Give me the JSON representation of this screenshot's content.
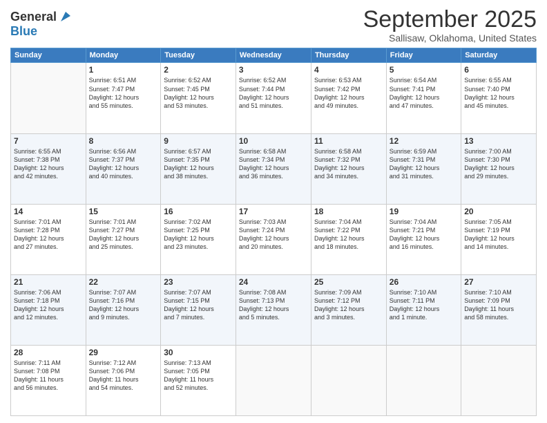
{
  "header": {
    "logo_line1": "General",
    "logo_line2": "Blue",
    "main_title": "September 2025",
    "subtitle": "Sallisaw, Oklahoma, United States"
  },
  "days_of_week": [
    "Sunday",
    "Monday",
    "Tuesday",
    "Wednesday",
    "Thursday",
    "Friday",
    "Saturday"
  ],
  "weeks": [
    [
      {
        "day": "",
        "info": ""
      },
      {
        "day": "1",
        "info": "Sunrise: 6:51 AM\nSunset: 7:47 PM\nDaylight: 12 hours\nand 55 minutes."
      },
      {
        "day": "2",
        "info": "Sunrise: 6:52 AM\nSunset: 7:45 PM\nDaylight: 12 hours\nand 53 minutes."
      },
      {
        "day": "3",
        "info": "Sunrise: 6:52 AM\nSunset: 7:44 PM\nDaylight: 12 hours\nand 51 minutes."
      },
      {
        "day": "4",
        "info": "Sunrise: 6:53 AM\nSunset: 7:42 PM\nDaylight: 12 hours\nand 49 minutes."
      },
      {
        "day": "5",
        "info": "Sunrise: 6:54 AM\nSunset: 7:41 PM\nDaylight: 12 hours\nand 47 minutes."
      },
      {
        "day": "6",
        "info": "Sunrise: 6:55 AM\nSunset: 7:40 PM\nDaylight: 12 hours\nand 45 minutes."
      }
    ],
    [
      {
        "day": "7",
        "info": "Sunrise: 6:55 AM\nSunset: 7:38 PM\nDaylight: 12 hours\nand 42 minutes."
      },
      {
        "day": "8",
        "info": "Sunrise: 6:56 AM\nSunset: 7:37 PM\nDaylight: 12 hours\nand 40 minutes."
      },
      {
        "day": "9",
        "info": "Sunrise: 6:57 AM\nSunset: 7:35 PM\nDaylight: 12 hours\nand 38 minutes."
      },
      {
        "day": "10",
        "info": "Sunrise: 6:58 AM\nSunset: 7:34 PM\nDaylight: 12 hours\nand 36 minutes."
      },
      {
        "day": "11",
        "info": "Sunrise: 6:58 AM\nSunset: 7:32 PM\nDaylight: 12 hours\nand 34 minutes."
      },
      {
        "day": "12",
        "info": "Sunrise: 6:59 AM\nSunset: 7:31 PM\nDaylight: 12 hours\nand 31 minutes."
      },
      {
        "day": "13",
        "info": "Sunrise: 7:00 AM\nSunset: 7:30 PM\nDaylight: 12 hours\nand 29 minutes."
      }
    ],
    [
      {
        "day": "14",
        "info": "Sunrise: 7:01 AM\nSunset: 7:28 PM\nDaylight: 12 hours\nand 27 minutes."
      },
      {
        "day": "15",
        "info": "Sunrise: 7:01 AM\nSunset: 7:27 PM\nDaylight: 12 hours\nand 25 minutes."
      },
      {
        "day": "16",
        "info": "Sunrise: 7:02 AM\nSunset: 7:25 PM\nDaylight: 12 hours\nand 23 minutes."
      },
      {
        "day": "17",
        "info": "Sunrise: 7:03 AM\nSunset: 7:24 PM\nDaylight: 12 hours\nand 20 minutes."
      },
      {
        "day": "18",
        "info": "Sunrise: 7:04 AM\nSunset: 7:22 PM\nDaylight: 12 hours\nand 18 minutes."
      },
      {
        "day": "19",
        "info": "Sunrise: 7:04 AM\nSunset: 7:21 PM\nDaylight: 12 hours\nand 16 minutes."
      },
      {
        "day": "20",
        "info": "Sunrise: 7:05 AM\nSunset: 7:19 PM\nDaylight: 12 hours\nand 14 minutes."
      }
    ],
    [
      {
        "day": "21",
        "info": "Sunrise: 7:06 AM\nSunset: 7:18 PM\nDaylight: 12 hours\nand 12 minutes."
      },
      {
        "day": "22",
        "info": "Sunrise: 7:07 AM\nSunset: 7:16 PM\nDaylight: 12 hours\nand 9 minutes."
      },
      {
        "day": "23",
        "info": "Sunrise: 7:07 AM\nSunset: 7:15 PM\nDaylight: 12 hours\nand 7 minutes."
      },
      {
        "day": "24",
        "info": "Sunrise: 7:08 AM\nSunset: 7:13 PM\nDaylight: 12 hours\nand 5 minutes."
      },
      {
        "day": "25",
        "info": "Sunrise: 7:09 AM\nSunset: 7:12 PM\nDaylight: 12 hours\nand 3 minutes."
      },
      {
        "day": "26",
        "info": "Sunrise: 7:10 AM\nSunset: 7:11 PM\nDaylight: 12 hours\nand 1 minute."
      },
      {
        "day": "27",
        "info": "Sunrise: 7:10 AM\nSunset: 7:09 PM\nDaylight: 11 hours\nand 58 minutes."
      }
    ],
    [
      {
        "day": "28",
        "info": "Sunrise: 7:11 AM\nSunset: 7:08 PM\nDaylight: 11 hours\nand 56 minutes."
      },
      {
        "day": "29",
        "info": "Sunrise: 7:12 AM\nSunset: 7:06 PM\nDaylight: 11 hours\nand 54 minutes."
      },
      {
        "day": "30",
        "info": "Sunrise: 7:13 AM\nSunset: 7:05 PM\nDaylight: 11 hours\nand 52 minutes."
      },
      {
        "day": "",
        "info": ""
      },
      {
        "day": "",
        "info": ""
      },
      {
        "day": "",
        "info": ""
      },
      {
        "day": "",
        "info": ""
      }
    ]
  ]
}
